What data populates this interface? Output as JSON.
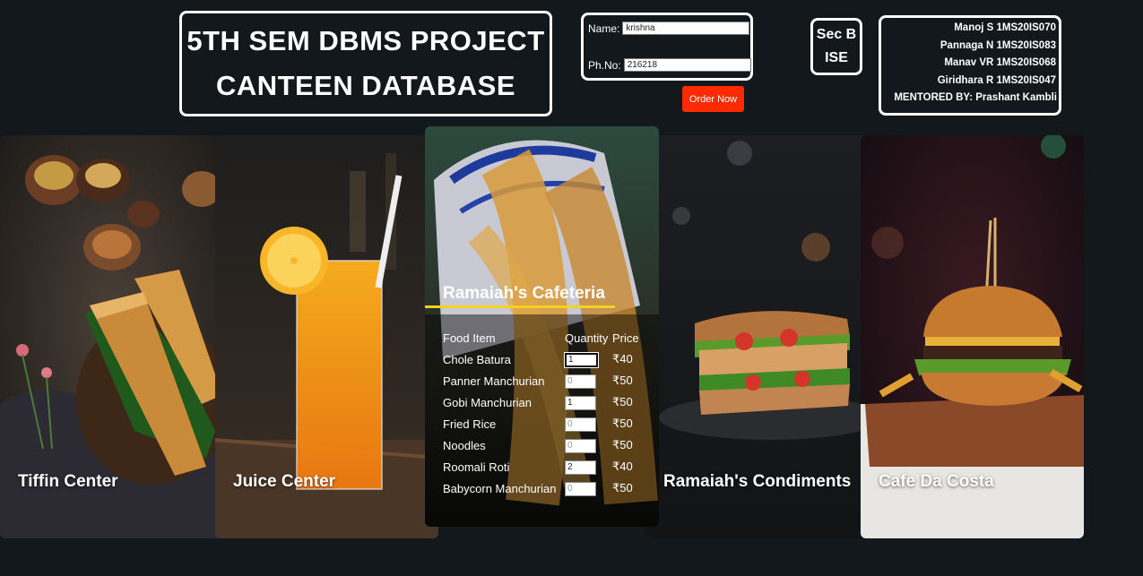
{
  "header": {
    "title_line1": "5TH SEM DBMS PROJECT",
    "title_line2": "CANTEEN DATABASE"
  },
  "order_form": {
    "name_label": "Name:",
    "name_value": "krishna",
    "phone_label": "Ph.No:",
    "phone_value": "216218",
    "submit_label": "Order Now"
  },
  "section": {
    "line1": "Sec B",
    "line2": "ISE"
  },
  "team": {
    "members": [
      "Manoj S 1MS20IS070",
      "Pannaga N 1MS20IS083",
      "Manav VR 1MS20IS068",
      "Giridhara R 1MS20IS047"
    ],
    "mentor": "MENTORED BY: Prashant Kambli"
  },
  "cards": {
    "tiffin": "Tiffin Center",
    "juice": "Juice Center",
    "condiments": "Ramaiah's Condiments",
    "costa": "Cafe Da Costa"
  },
  "menu": {
    "title": "Ramaiah's Cafeteria",
    "headers": [
      "Food Item",
      "Quantity",
      "Price"
    ],
    "items": [
      {
        "name": "Chole Batura",
        "qty": "1",
        "price": "₹40"
      },
      {
        "name": "Panner Manchurian",
        "qty": "0",
        "price": "₹50"
      },
      {
        "name": "Gobi Manchurian",
        "qty": "1",
        "price": "₹50"
      },
      {
        "name": "Fried Rice",
        "qty": "0",
        "price": "₹50"
      },
      {
        "name": "Noodles",
        "qty": "0",
        "price": "₹50"
      },
      {
        "name": "Roomali Roti",
        "qty": "2",
        "price": "₹40"
      },
      {
        "name": "Babycorn Manchurian",
        "qty": "0",
        "price": "₹50"
      }
    ]
  },
  "colors": {
    "background": "#12181c",
    "order_button": "#ff2a00",
    "accent_underline": "#f5d21e"
  }
}
